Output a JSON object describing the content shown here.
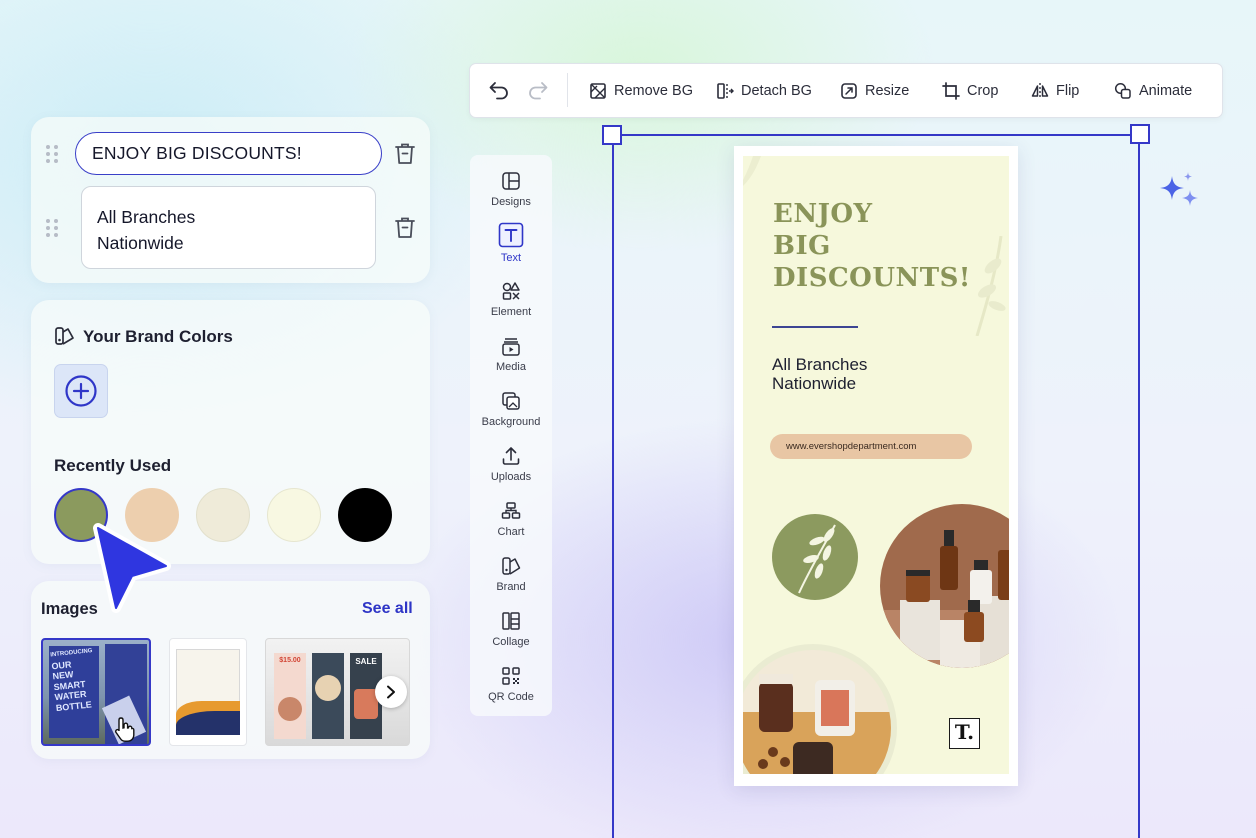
{
  "toolbar": {
    "remove_bg": "Remove BG",
    "detach_bg": "Detach BG",
    "resize": "Resize",
    "crop": "Crop",
    "flip": "Flip",
    "animate": "Animate"
  },
  "text_fields": {
    "headline": "ENJOY BIG DISCOUNTS!",
    "subtext_line1": "All Branches",
    "subtext_line2": "Nationwide"
  },
  "brand_colors": {
    "title": "Your Brand Colors",
    "recently_used_label": "Recently Used",
    "swatches": [
      "#8b9a5e",
      "#edcfae",
      "#efebd9",
      "#f8f8e2",
      "#000000"
    ]
  },
  "images": {
    "title": "Images",
    "see_all": "See all",
    "thumb1_lines": [
      "INTRODUCING",
      "OUR",
      "NEW",
      "SMART",
      "WATER",
      "BOTTLE"
    ],
    "thumb3_price": "$15.00",
    "thumb3_sale": "SALE"
  },
  "side_rail": {
    "items": [
      "Designs",
      "Text",
      "Element",
      "Media",
      "Background",
      "Uploads",
      "Chart",
      "Brand",
      "Collage",
      "QR Code"
    ],
    "active": "Text"
  },
  "poster": {
    "headline_lines": [
      "ENJOY",
      "BIG",
      "DISCOUNTS!"
    ],
    "sub_line1": "All Branches",
    "sub_line2": "Nationwide",
    "url": "www.evershopdepartment.com",
    "logo": "T."
  },
  "colors": {
    "accent": "#3538c8",
    "olive": "#8a9459",
    "poster_bg": "#f6f8dc"
  }
}
